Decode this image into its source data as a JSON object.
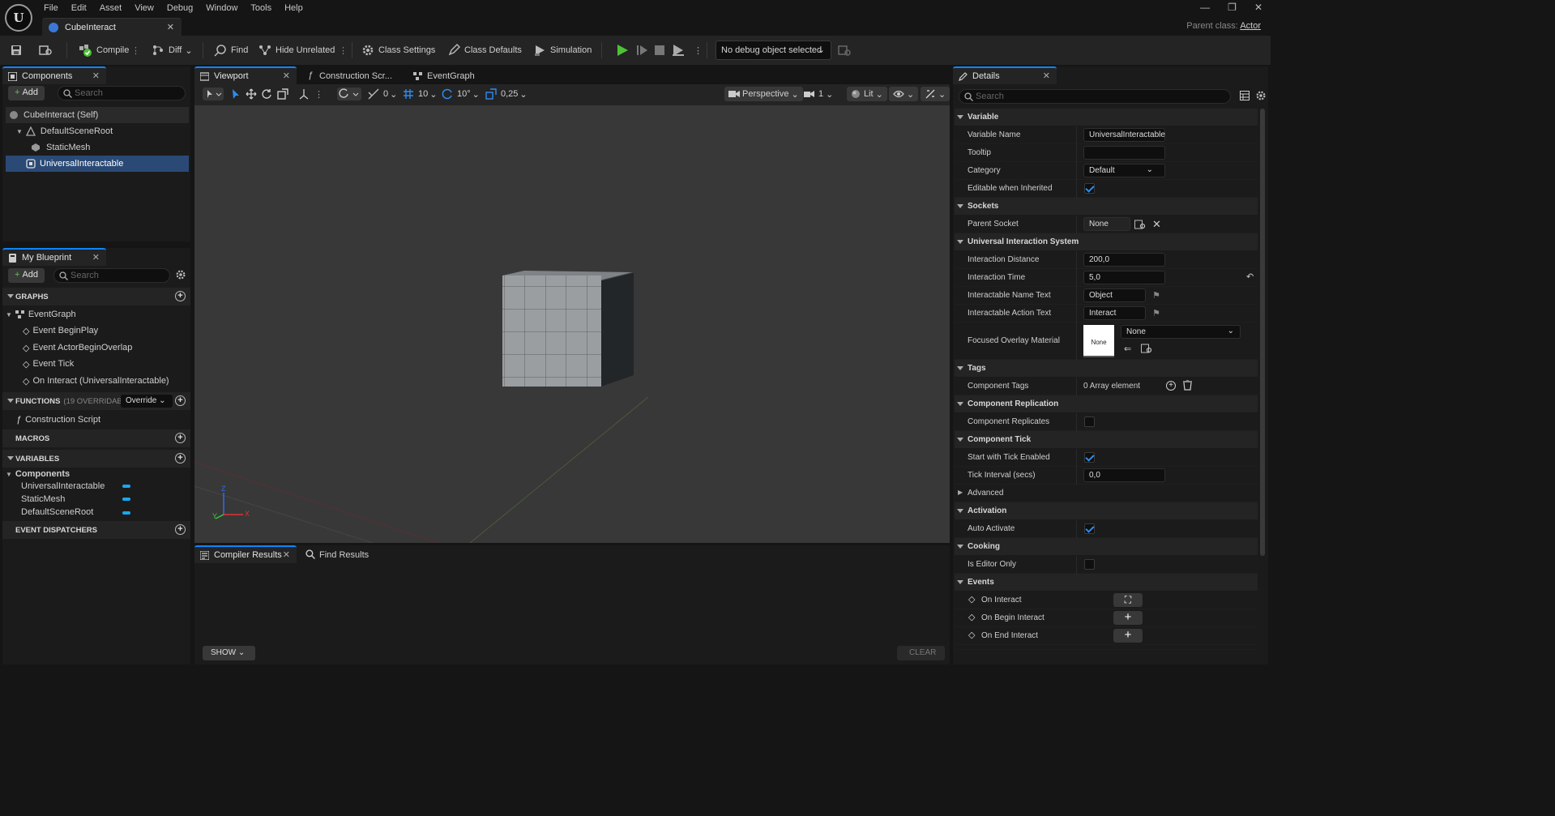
{
  "menu": [
    "File",
    "Edit",
    "Asset",
    "View",
    "Debug",
    "Window",
    "Tools",
    "Help"
  ],
  "document_tab": "CubeInteract",
  "logo_text": "U",
  "parent_class": {
    "label": "Parent class:",
    "value": "Actor"
  },
  "toolbar": {
    "compile": "Compile",
    "diff": "Diff",
    "find": "Find",
    "hide_unrelated": "Hide Unrelated",
    "class_settings": "Class Settings",
    "class_defaults": "Class Defaults",
    "simulation": "Simulation",
    "debug_object": "No debug object selected"
  },
  "components_panel": {
    "tab": "Components",
    "add": "Add",
    "search_placeholder": "Search",
    "items": [
      "CubeInteract (Self)",
      "DefaultSceneRoot",
      "StaticMesh",
      "UniversalInteractable"
    ]
  },
  "my_blueprint": {
    "tab": "My Blueprint",
    "add": "Add",
    "search_placeholder": "Search",
    "graphs_header": "GRAPHS",
    "event_graph": "EventGraph",
    "events": [
      "Event BeginPlay",
      "Event ActorBeginOverlap",
      "Event Tick",
      "On Interact (UniversalInteractable)"
    ],
    "functions_header": "FUNCTIONS",
    "functions_count": "(19 OVERRIDABLE)",
    "override": "Override",
    "construction_script": "Construction Script",
    "macros_header": "MACROS",
    "variables_header": "VARIABLES",
    "components_category": "Components",
    "variables": [
      "UniversalInteractable",
      "StaticMesh",
      "DefaultSceneRoot"
    ],
    "dispatchers_header": "EVENT DISPATCHERS"
  },
  "editor_tabs": [
    "Viewport",
    "Construction Scr...",
    "EventGraph"
  ],
  "viewport_toolbar": {
    "snap_angle": "0",
    "grid": "10",
    "rot": "10°",
    "scale": "0,25",
    "perspective": "Perspective",
    "cam_speed": "1",
    "lit": "Lit"
  },
  "axis_labels": {
    "z": "Z",
    "y": "Y",
    "x": "X"
  },
  "bottom_tabs": [
    "Compiler Results",
    "Find Results"
  ],
  "bottom_buttons": {
    "show": "SHOW",
    "clear": "CLEAR"
  },
  "details": {
    "tab": "Details",
    "search_placeholder": "Search",
    "sec_variable": "Variable",
    "variable_name_label": "Variable Name",
    "variable_name": "UniversalInteractable",
    "tooltip_label": "Tooltip",
    "tooltip": "",
    "category_label": "Category",
    "category": "Default",
    "editable_label": "Editable when Inherited",
    "sec_sockets": "Sockets",
    "parent_socket_label": "Parent Socket",
    "parent_socket": "None",
    "sec_uis": "Universal Interaction System",
    "interaction_distance_label": "Interaction Distance",
    "interaction_distance": "200,0",
    "interaction_time_label": "Interaction Time",
    "interaction_time": "5,0",
    "name_text_label": "Interactable Name Text",
    "name_text": "Object",
    "action_text_label": "Interactable Action Text",
    "action_text": "Interact",
    "overlay_label": "Focused Overlay Material",
    "overlay_thumb": "None",
    "overlay_value": "None",
    "sec_tags": "Tags",
    "component_tags_label": "Component Tags",
    "component_tags": "0 Array element",
    "sec_replication": "Component Replication",
    "replicates_label": "Component Replicates",
    "sec_tick": "Component Tick",
    "tick_enabled_label": "Start with Tick Enabled",
    "tick_interval_label": "Tick Interval (secs)",
    "tick_interval": "0,0",
    "advanced": "Advanced",
    "sec_activation": "Activation",
    "auto_activate_label": "Auto Activate",
    "sec_cooking": "Cooking",
    "editor_only_label": "Is Editor Only",
    "sec_events": "Events",
    "events": [
      "On Interact",
      "On Begin Interact",
      "On End Interact"
    ]
  },
  "colors": {
    "accent": "#0e85ff",
    "selection": "#2a4a75",
    "play": "#4cc234",
    "pill": "#1aa7ec"
  }
}
